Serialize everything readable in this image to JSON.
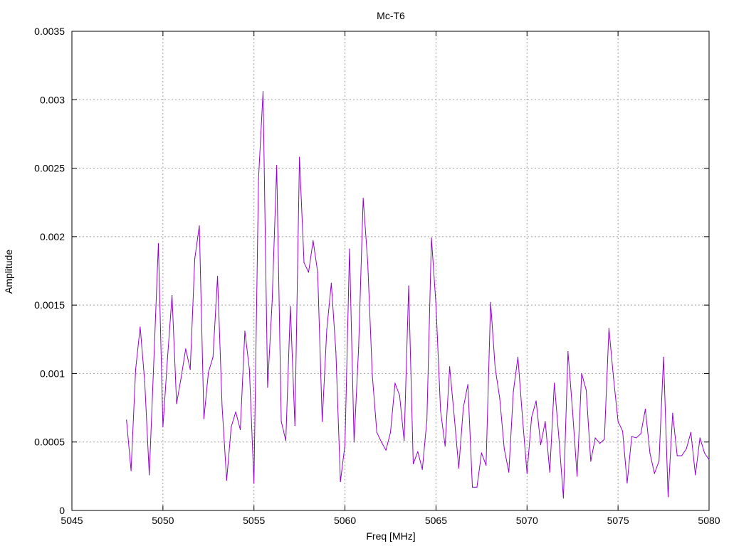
{
  "chart_data": {
    "type": "line",
    "title": "Mc-T6",
    "xlabel": "Freq [MHz]",
    "ylabel": "Amplitude",
    "xlim": [
      5045,
      5080
    ],
    "ylim": [
      0,
      0.0035
    ],
    "grid": true,
    "x_ticks": [
      "5045",
      "5050",
      "5055",
      "5060",
      "5065",
      "5070",
      "5075",
      "5080"
    ],
    "y_ticks": [
      "0",
      "0.0005",
      "0.001",
      "0.0015",
      "0.002",
      "0.0025",
      "0.003",
      "0.0035"
    ],
    "series": [
      {
        "color": "#9400d3",
        "x": [
          5048.0,
          5048.25,
          5048.5,
          5048.75,
          5049.0,
          5049.25,
          5049.5,
          5049.75,
          5050.0,
          5050.25,
          5050.5,
          5050.75,
          5051.0,
          5051.25,
          5051.5,
          5051.75,
          5052.0,
          5052.25,
          5052.5,
          5052.75,
          5053.0,
          5053.25,
          5053.5,
          5053.75,
          5054.0,
          5054.25,
          5054.5,
          5054.75,
          5055.0,
          5055.25,
          5055.5,
          5055.75,
          5056.0,
          5056.25,
          5056.5,
          5056.75,
          5057.0,
          5057.25,
          5057.5,
          5057.75,
          5058.0,
          5058.25,
          5058.5,
          5058.75,
          5059.0,
          5059.25,
          5059.5,
          5059.75,
          5060.0,
          5060.25,
          5060.5,
          5060.75,
          5061.0,
          5061.25,
          5061.5,
          5061.75,
          5062.0,
          5062.25,
          5062.5,
          5062.75,
          5063.0,
          5063.25,
          5063.5,
          5063.75,
          5064.0,
          5064.25,
          5064.5,
          5064.75,
          5065.0,
          5065.25,
          5065.5,
          5065.75,
          5066.0,
          5066.25,
          5066.5,
          5066.75,
          5067.0,
          5067.25,
          5067.5,
          5067.75,
          5068.0,
          5068.25,
          5068.5,
          5068.75,
          5069.0,
          5069.25,
          5069.5,
          5069.75,
          5070.0,
          5070.25,
          5070.5,
          5070.75,
          5071.0,
          5071.25,
          5071.5,
          5071.75,
          5072.0,
          5072.25,
          5072.5,
          5072.75,
          5073.0,
          5073.25,
          5073.5,
          5073.75,
          5074.0,
          5074.25,
          5074.5,
          5074.75,
          5075.0,
          5075.25,
          5075.5,
          5075.75,
          5076.0,
          5076.25,
          5076.5,
          5076.75,
          5077.0,
          5077.25,
          5077.5,
          5077.75,
          5078.0,
          5078.25,
          5078.5,
          5078.75,
          5079.0,
          5079.25,
          5079.5,
          5079.75,
          5080.0
        ],
        "y": [
          0.00066,
          0.00029,
          0.00103,
          0.00134,
          0.00094,
          0.00026,
          0.00109,
          0.00195,
          0.00061,
          0.00111,
          0.00157,
          0.00078,
          0.00097,
          0.00118,
          0.00103,
          0.00184,
          0.00208,
          0.00067,
          0.00101,
          0.00112,
          0.00171,
          0.00076,
          0.00022,
          0.00061,
          0.00072,
          0.00059,
          0.00131,
          0.00103,
          0.0002,
          0.00242,
          0.00306,
          0.0009,
          0.00153,
          0.00252,
          0.00065,
          0.00051,
          0.00149,
          0.00062,
          0.00258,
          0.00181,
          0.00174,
          0.00197,
          0.00174,
          0.00065,
          0.00132,
          0.00166,
          0.00116,
          0.00021,
          0.00048,
          0.00191,
          0.0005,
          0.00119,
          0.00228,
          0.00181,
          0.00099,
          0.00057,
          0.0005,
          0.00044,
          0.00057,
          0.00093,
          0.00084,
          0.00051,
          0.00164,
          0.00034,
          0.00043,
          0.0003,
          0.00066,
          0.00199,
          0.0015,
          0.00073,
          0.00047,
          0.00105,
          0.00069,
          0.00031,
          0.00075,
          0.00092,
          0.00017,
          0.00017,
          0.00042,
          0.00033,
          0.00152,
          0.00104,
          0.00082,
          0.00045,
          0.00028,
          0.00087,
          0.00112,
          0.00068,
          0.00027,
          0.00068,
          0.0008,
          0.00048,
          0.00065,
          0.00028,
          0.00093,
          0.00053,
          9e-05,
          0.00116,
          0.00073,
          0.00025,
          0.001,
          0.00088,
          0.00036,
          0.00053,
          0.00049,
          0.00052,
          0.00133,
          0.00097,
          0.00065,
          0.00058,
          0.0002,
          0.00054,
          0.00053,
          0.00056,
          0.00074,
          0.00042,
          0.00027,
          0.00036,
          0.00112,
          0.0001,
          0.00071,
          0.0004,
          0.0004,
          0.00045,
          0.00057,
          0.00026,
          0.00053,
          0.00042,
          0.00037
        ]
      }
    ]
  }
}
